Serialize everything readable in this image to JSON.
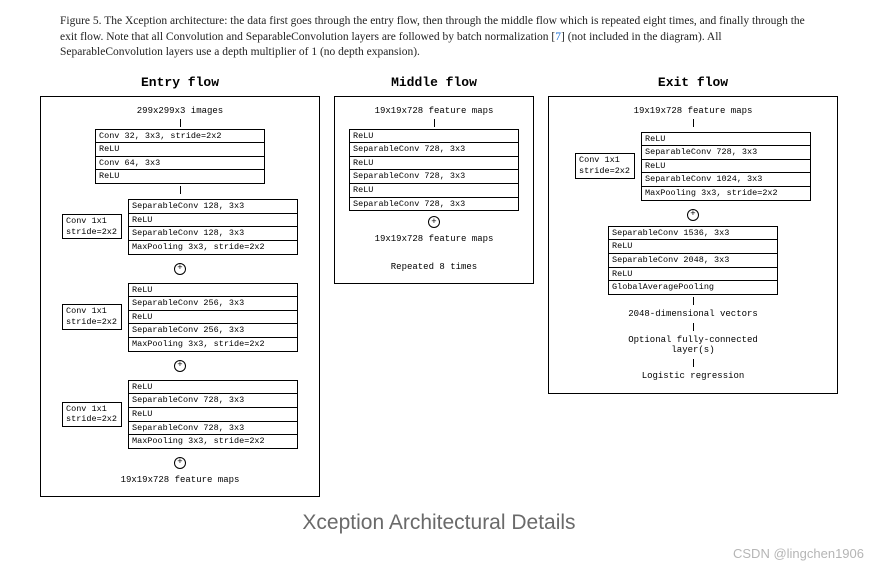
{
  "caption_prefix": "Figure 5. The Xception architecture: the data first goes through the entry flow, then through the middle flow which is repeated eight times, and finally through the exit flow. Note that all Convolution and SeparableConvolution layers are followed by batch normalization [",
  "caption_ref": "7",
  "caption_suffix": "] (not included in the diagram). All SeparableConvolution layers use a depth multiplier of 1 (no depth expansion).",
  "entry": {
    "title": "Entry flow",
    "input": "299x299x3 images",
    "conv1": "Conv 32, 3x3, stride=2x2",
    "relu": "ReLU",
    "conv2": "Conv 64, 3x3",
    "side": "Conv 1x1\nstride=2x2",
    "b1_a": "SeparableConv 128, 3x3",
    "b1_b": "SeparableConv 128, 3x3",
    "mp": "MaxPooling 3x3, stride=2x2",
    "b2_a": "SeparableConv 256, 3x3",
    "b2_b": "SeparableConv 256, 3x3",
    "b3_a": "SeparableConv 728, 3x3",
    "b3_b": "SeparableConv 728, 3x3",
    "out": "19x19x728 feature maps"
  },
  "middle": {
    "title": "Middle flow",
    "input": "19x19x728 feature maps",
    "relu": "ReLU",
    "sep": "SeparableConv 728, 3x3",
    "out": "19x19x728 feature maps",
    "repeat": "Repeated 8 times"
  },
  "exit": {
    "title": "Exit flow",
    "input": "19x19x728 feature maps",
    "side": "Conv 1x1\nstride=2x2",
    "relu": "ReLU",
    "sep728": "SeparableConv 728, 3x3",
    "sep1024": "SeparableConv 1024, 3x3",
    "mp": "MaxPooling 3x3, stride=2x2",
    "sep1536": "SeparableConv 1536, 3x3",
    "sep2048": "SeparableConv 2048, 3x3",
    "gap": "GlobalAveragePooling",
    "vec": "2048-dimensional vectors",
    "fc": "Optional fully-connected\nlayer(s)",
    "lr": "Logistic regression"
  },
  "subtitle": "Xception Architectural Details",
  "watermark": "CSDN @lingchen1906"
}
